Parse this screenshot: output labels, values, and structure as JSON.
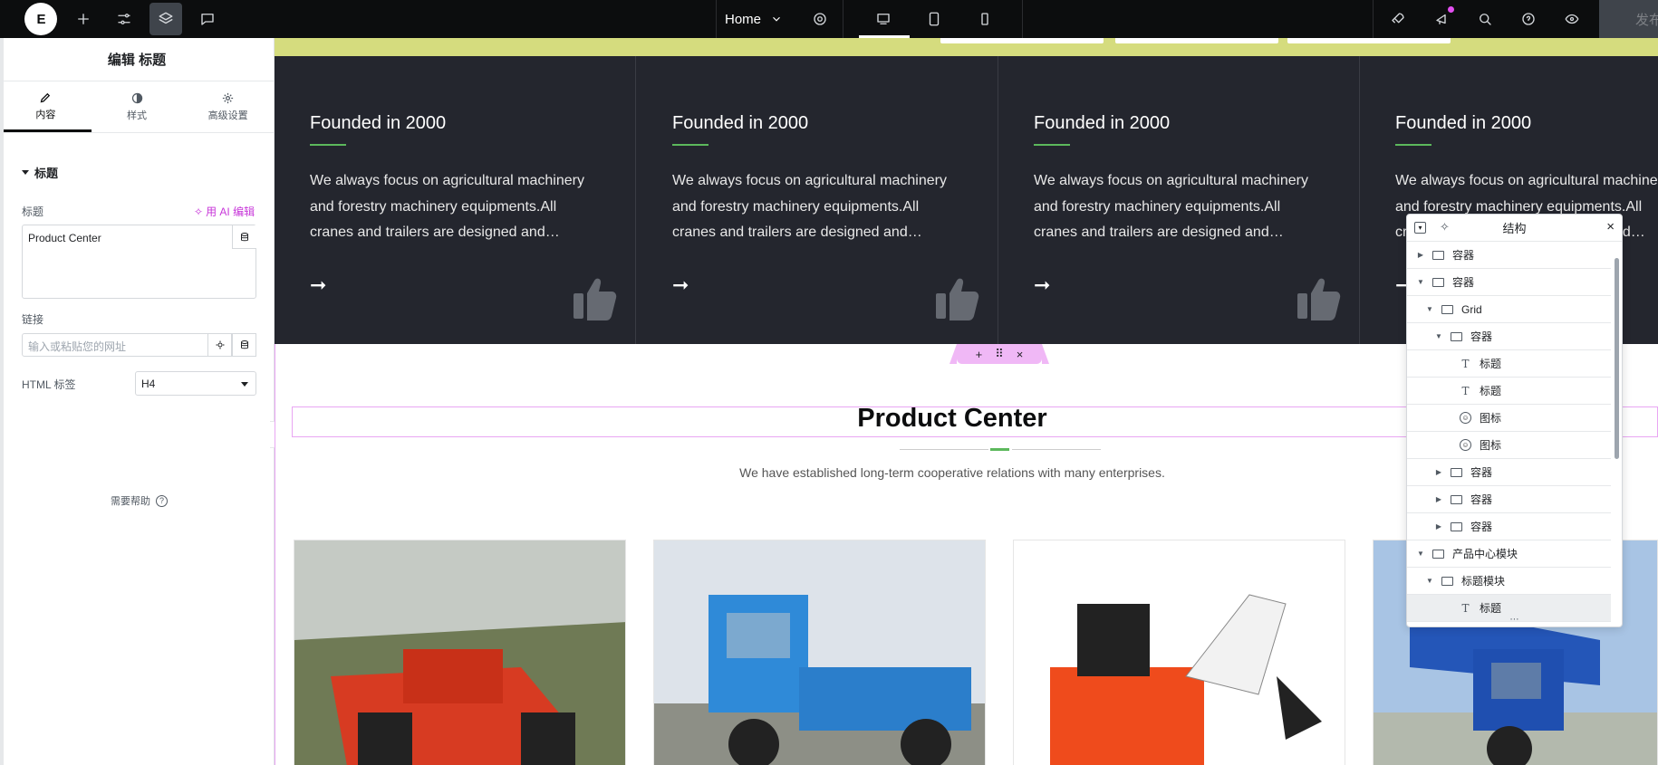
{
  "topbar": {
    "logo": "E",
    "page_selector": "Home",
    "publish_label": "发布"
  },
  "panel": {
    "title": "编辑 标题",
    "tabs": [
      {
        "label": "内容",
        "icon": "pencil-icon"
      },
      {
        "label": "样式",
        "icon": "contrast-icon"
      },
      {
        "label": "高级设置",
        "icon": "gear-icon"
      }
    ],
    "section_title": "标题",
    "title_field_label": "标题",
    "ai_edit_label": "用 AI 编辑",
    "title_value": "Product Center",
    "link_label": "链接",
    "link_placeholder": "输入或粘贴您的网址",
    "html_tag_label": "HTML 标签",
    "html_tag_value": "H4",
    "help_label": "需要帮助"
  },
  "canvas": {
    "cards": [
      {
        "title": "Founded in 2000",
        "text": "We always focus on agricultural machinery and forestry machinery equipments.All cranes and trailers are designed and…"
      },
      {
        "title": "Founded in 2000",
        "text": "We always focus on agricultural machinery and forestry machinery equipments.All cranes and trailers are designed and…"
      },
      {
        "title": "Founded in 2000",
        "text": "We always focus on agricultural machinery and forestry machinery equipments.All cranes and trailers are designed and…"
      },
      {
        "title": "Founded in 2000",
        "text": "We always focus on agricultural machinery and forestry machinery equipments.All cranes and trailers are designed and…"
      }
    ],
    "handle": {
      "add": "+",
      "move": "⠿",
      "close": "×"
    },
    "section_title": "Product Center",
    "section_subtitle": "We have established long-term cooperative relations with many enterprises.",
    "accent_color": "#5cb85c",
    "dark_bg": "#24262e"
  },
  "structure": {
    "title": "结构",
    "rows": [
      {
        "label": "容器",
        "arrow": "▶",
        "icon": "container-icon"
      },
      {
        "label": "容器",
        "arrow": "▼",
        "icon": "container-icon"
      },
      {
        "label": "Grid",
        "arrow": "▼",
        "icon": "grid-icon"
      },
      {
        "label": "容器",
        "arrow": "▼",
        "icon": "container-icon"
      },
      {
        "label": "标题",
        "arrow": "",
        "icon": "heading-icon"
      },
      {
        "label": "标题",
        "arrow": "",
        "icon": "heading-icon"
      },
      {
        "label": "图标",
        "arrow": "",
        "icon": "icon-widget-icon"
      },
      {
        "label": "图标",
        "arrow": "",
        "icon": "icon-widget-icon"
      },
      {
        "label": "容器",
        "arrow": "▶",
        "icon": "container-icon"
      },
      {
        "label": "容器",
        "arrow": "▶",
        "icon": "container-icon"
      },
      {
        "label": "容器",
        "arrow": "▶",
        "icon": "container-icon"
      },
      {
        "label": "产品中心模块",
        "arrow": "▼",
        "icon": "container-icon"
      },
      {
        "label": "标题模块",
        "arrow": "▼",
        "icon": "container-icon"
      },
      {
        "label": "标题",
        "arrow": "",
        "icon": "heading-icon"
      }
    ]
  }
}
